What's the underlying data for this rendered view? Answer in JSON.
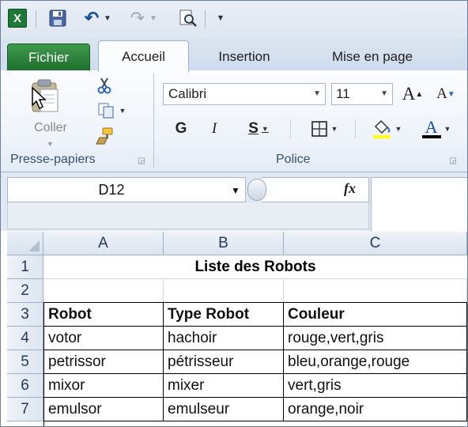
{
  "qat": {
    "app_icon_label": "X",
    "save_label": "Enregistrer",
    "undo_label": "Annuler",
    "redo_label": "Rétablir",
    "print_preview_label": "Aperçu"
  },
  "tabs": [
    {
      "label": "Fichier"
    },
    {
      "label": "Accueil"
    },
    {
      "label": "Insertion"
    },
    {
      "label": "Mise en page"
    }
  ],
  "ribbon": {
    "clipboard": {
      "paste_label": "Coller",
      "group_label": "Presse-papiers",
      "icons": [
        "paste-icon",
        "cut-icon",
        "copy-icon",
        "format-painter-icon"
      ]
    },
    "font": {
      "font_name": "Calibri",
      "font_size": "11",
      "bold_label": "G",
      "italic_label": "I",
      "underline_label": "S",
      "grow_label": "A",
      "shrink_label": "A",
      "font_color_label": "A",
      "group_label": "Police",
      "fill_color": "#ffff00",
      "font_color": "#000000"
    }
  },
  "formula_bar": {
    "name_box": "D12",
    "fx_label": "fx",
    "formula": ""
  },
  "sheet": {
    "columns": [
      "A",
      "B",
      "C"
    ],
    "rows": [
      "1",
      "2",
      "3",
      "4",
      "5",
      "6",
      "7"
    ],
    "title": "Liste des Robots",
    "headers": [
      "Robot",
      "Type Robot",
      "Couleur"
    ],
    "data": [
      [
        "votor",
        "hachoir",
        "rouge,vert,gris"
      ],
      [
        "petrissor",
        "pétrisseur",
        "bleu,orange,rouge"
      ],
      [
        "mixor",
        "mixer",
        "vert,gris"
      ],
      [
        "emulsor",
        "emulseur",
        "orange,noir"
      ]
    ]
  }
}
